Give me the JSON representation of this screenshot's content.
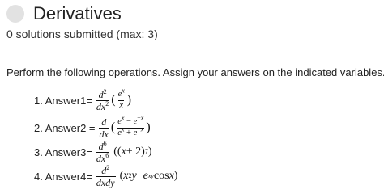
{
  "problem": {
    "title": "Derivatives",
    "submissions": "0 solutions submitted (max: 3)",
    "instructions": "Perform the following operations.  Assign your answers on the indicated variables."
  },
  "questions": [
    {
      "label": "1. Answer1="
    },
    {
      "label": "2. Answer2 ="
    },
    {
      "label": "3. Answer3="
    },
    {
      "label": "4. Answer4="
    }
  ],
  "colors": {
    "status_circle": "#e2e2e2",
    "text": "#222222"
  },
  "icons": {
    "status": "status-circle-icon"
  }
}
